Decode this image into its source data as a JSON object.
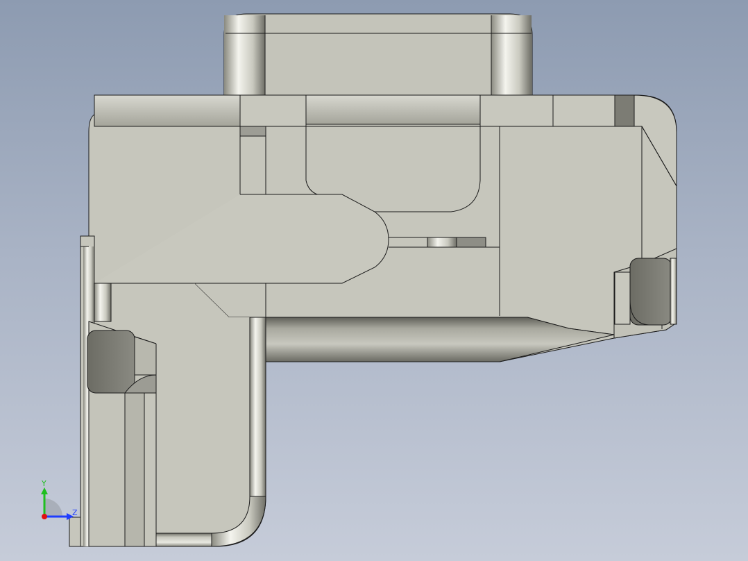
{
  "viewport": {
    "background_top": "#8d9bb1",
    "background_bottom": "#c6ccd9"
  },
  "model": {
    "face_color": "#c6c6bc",
    "face_shade_color": "#b4b4a8",
    "dark_face_color": "#7e7e76",
    "edge_color": "#1a1a1a"
  },
  "triad": {
    "y_label": "Y",
    "z_label": "Z",
    "y_color": "#1fbf1f",
    "z_color": "#1e3cff",
    "x_color": "#e01010"
  }
}
